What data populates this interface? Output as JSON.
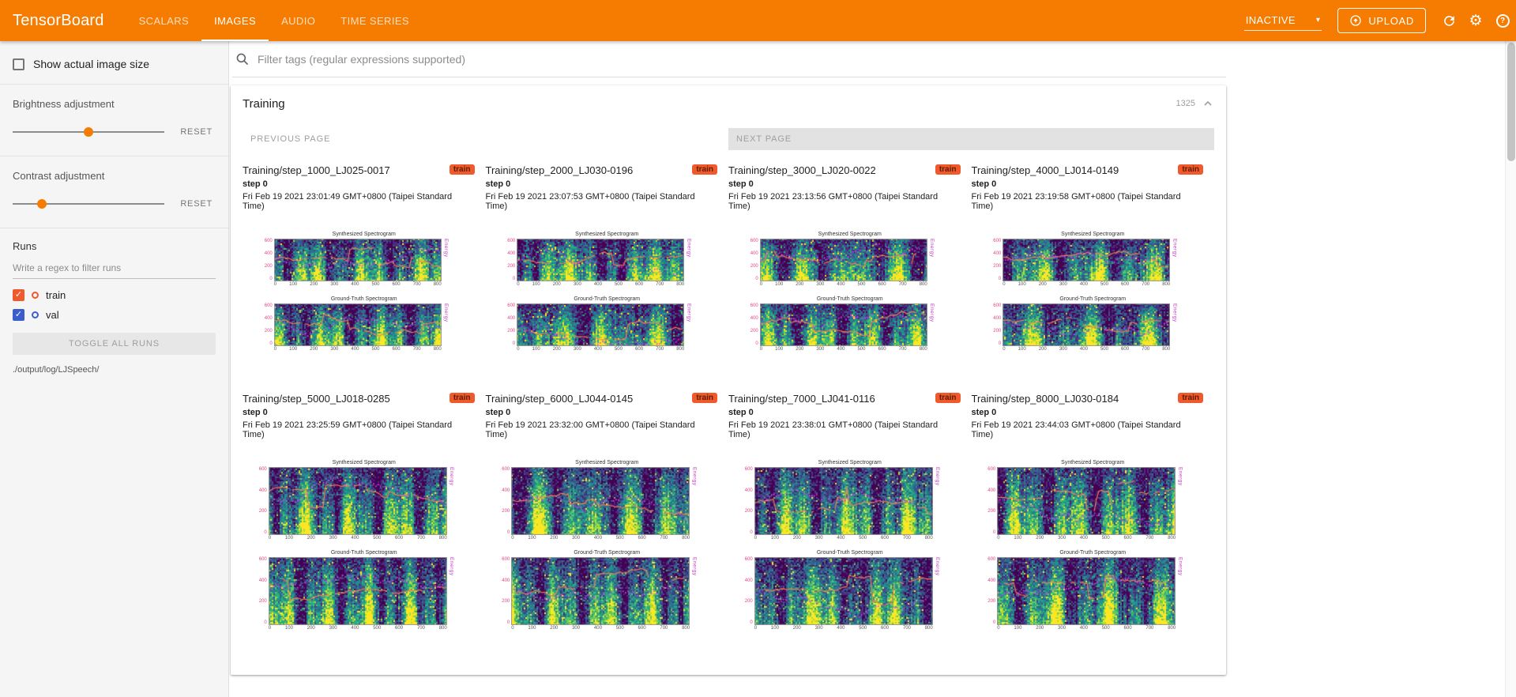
{
  "topbar": {
    "title": "TensorBoard",
    "color": "#f57c00",
    "tabs": [
      {
        "label": "SCALARS",
        "active": false
      },
      {
        "label": "IMAGES",
        "active": true
      },
      {
        "label": "AUDIO",
        "active": false
      },
      {
        "label": "TIME SERIES",
        "active": false
      }
    ],
    "status": "INACTIVE",
    "upload_label": "UPLOAD"
  },
  "sidebar": {
    "show_actual_size": "Show actual image size",
    "brightness_label": "Brightness adjustment",
    "contrast_label": "Contrast adjustment",
    "reset_label": "RESET",
    "runs_title": "Runs",
    "regex_placeholder": "Write a regex to filter runs",
    "runs": [
      {
        "name": "train",
        "color": "#f0592b",
        "checked": true
      },
      {
        "name": "val",
        "color": "#3a5fcd",
        "checked": true
      }
    ],
    "toggle_all": "TOGGLE ALL RUNS",
    "log_path": "./output/log/LJSpeech/"
  },
  "main": {
    "filter_placeholder": "Filter tags (regular expressions supported)",
    "section_title": "Training",
    "section_count": "1325",
    "prev_label": "PREVIOUS PAGE",
    "next_label": "NEXT PAGE",
    "plot": {
      "titles": [
        "Synthesized Spectrogram",
        "Ground-Truth Spectrogram"
      ],
      "right_axis_label": "Energy",
      "x_ticks": [
        "0",
        "100",
        "200",
        "300",
        "400",
        "500",
        "600",
        "700",
        "800"
      ],
      "y_ticks": [
        "600",
        "400",
        "200",
        "0"
      ]
    },
    "cards": [
      {
        "title": "Training/step_1000_LJ025-0017",
        "badge": "train",
        "step": "step 0",
        "time": "Fri Feb 19 2021 23:01:49 GMT+0800 (Taipei Standard Time)"
      },
      {
        "title": "Training/step_2000_LJ030-0196",
        "badge": "train",
        "step": "step 0",
        "time": "Fri Feb 19 2021 23:07:53 GMT+0800 (Taipei Standard Time)"
      },
      {
        "title": "Training/step_3000_LJ020-0022",
        "badge": "train",
        "step": "step 0",
        "time": "Fri Feb 19 2021 23:13:56 GMT+0800 (Taipei Standard Time)"
      },
      {
        "title": "Training/step_4000_LJ014-0149",
        "badge": "train",
        "step": "step 0",
        "time": "Fri Feb 19 2021 23:19:58 GMT+0800 (Taipei Standard Time)"
      },
      {
        "title": "Training/step_5000_LJ018-0285",
        "badge": "train",
        "step": "step 0",
        "time": "Fri Feb 19 2021 23:25:59 GMT+0800 (Taipei Standard Time)"
      },
      {
        "title": "Training/step_6000_LJ044-0145",
        "badge": "train",
        "step": "step 0",
        "time": "Fri Feb 19 2021 23:32:00 GMT+0800 (Taipei Standard Time)"
      },
      {
        "title": "Training/step_7000_LJ041-0116",
        "badge": "train",
        "step": "step 0",
        "time": "Fri Feb 19 2021 23:38:01 GMT+0800 (Taipei Standard Time)"
      },
      {
        "title": "Training/step_8000_LJ030-0184",
        "badge": "train",
        "step": "step 0",
        "time": "Fri Feb 19 2021 23:44:03 GMT+0800 (Taipei Standard Time)"
      }
    ]
  }
}
